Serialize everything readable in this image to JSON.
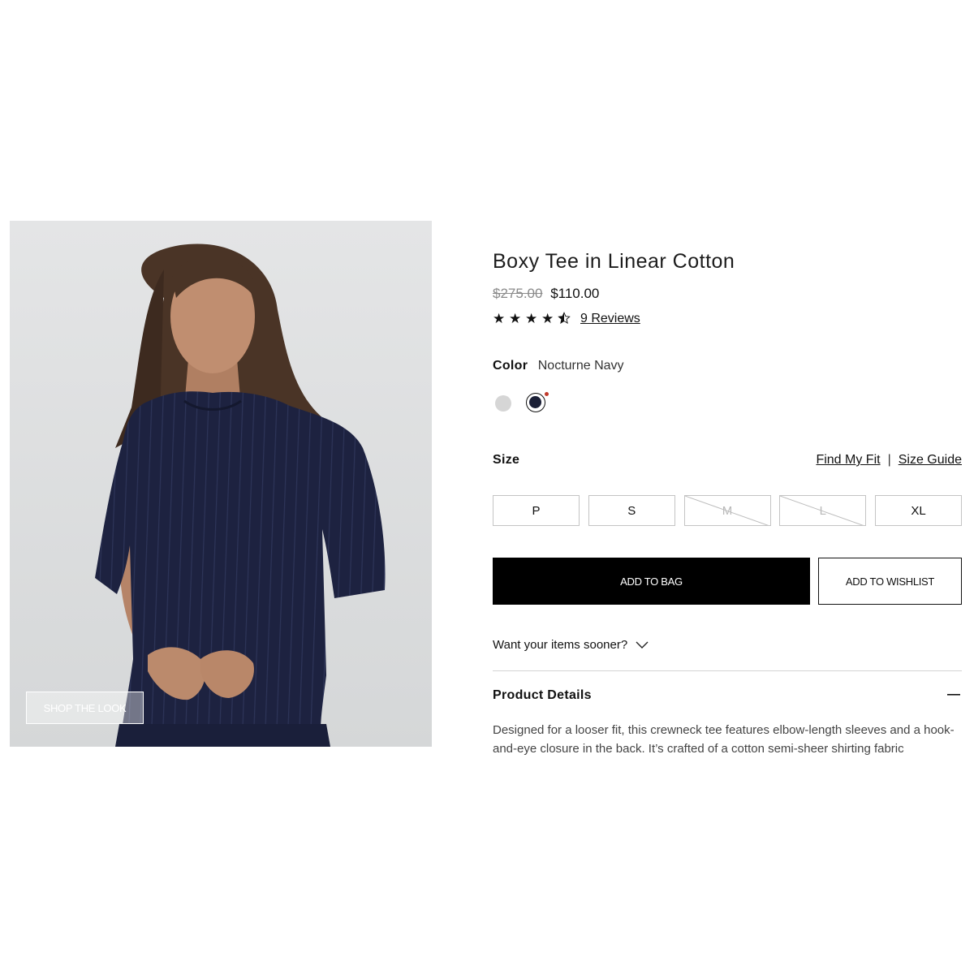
{
  "shop_the_look": {
    "label": "SHOP THE LOOK"
  },
  "product": {
    "title": "Boxy Tee in Linear Cotton",
    "price_original": "$275.00",
    "price_sale": "$110.00",
    "rating": 4.5,
    "rating_max": 5,
    "reviews_link": "9 Reviews"
  },
  "color": {
    "label": "Color",
    "selected": "Nocturne Navy",
    "swatches": [
      {
        "name": "light-grey",
        "hex": "#d6d6d6",
        "selected": false
      },
      {
        "name": "nocturne-navy",
        "hex": "#1a1f36",
        "selected": true
      }
    ]
  },
  "size": {
    "label": "Size",
    "find_my_fit": "Find My Fit",
    "separator": "|",
    "size_guide": "Size Guide",
    "options": [
      {
        "label": "P",
        "available": true
      },
      {
        "label": "S",
        "available": true
      },
      {
        "label": "M",
        "available": false
      },
      {
        "label": "L",
        "available": false
      },
      {
        "label": "XL",
        "available": true
      }
    ]
  },
  "actions": {
    "add_to_bag": "ADD TO BAG",
    "add_to_wishlist": "ADD TO WISHLIST"
  },
  "delivery": {
    "sooner": "Want your items sooner?"
  },
  "details": {
    "heading": "Product Details",
    "description": "Designed for a looser fit, this crewneck tee features elbow-length sleeves and a hook-and-eye closure in the back. It’s crafted of a cotton semi-sheer shirting fabric"
  }
}
